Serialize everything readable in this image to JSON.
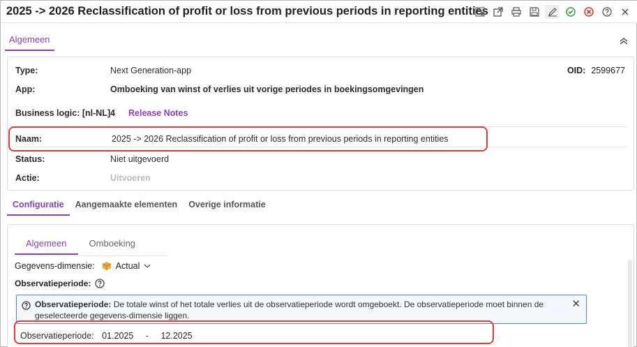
{
  "window": {
    "title": "2025 -> 2026 Reclassification of profit or loss from previous periods in reporting entities"
  },
  "toolbar": {
    "icons": [
      "layout-icon",
      "open-external-icon",
      "print-icon",
      "save-icon",
      "edit-icon",
      "approve-icon",
      "reject-icon",
      "help-icon",
      "close-icon"
    ]
  },
  "top_tab": {
    "label": "Algemeen"
  },
  "details": {
    "type_label": "Type:",
    "type_value": "Next Generation-app",
    "oid_label": "OID:",
    "oid_value": "2599677",
    "app_label": "App:",
    "app_value": "Omboeking van winst of verlies uit vorige periodes in boekingsomgevingen",
    "bl_label": "Business logic: [nl-NL]",
    "bl_value": "4",
    "release_notes": "Release Notes",
    "naam_label": "Naam:",
    "naam_value": "2025 -> 2026 Reclassification of profit or loss from previous periods in reporting entities",
    "status_label": "Status:",
    "status_value": "Niet uitgevoerd",
    "actie_label": "Actie:",
    "actie_value": "Uitvoeren"
  },
  "section_tabs": [
    "Configuratie",
    "Aangemaakte elementen",
    "Overige informatie"
  ],
  "inner_tabs": [
    "Algemeen",
    "Omboeking"
  ],
  "config": {
    "dimension_label": "Gegevens-dimensie:",
    "dimension_value": "Actual",
    "obs_label": "Observatieperiode:",
    "info_title": "Observatieperiode:",
    "info_text": "De totale winst of het totale verlies uit de observatieperiode wordt omgeboekt. De observatieperiode moet binnen de geselecteerde gegevens-dimensie liggen.",
    "period_label": "Observatieperiode:",
    "period_from": "01.2025",
    "period_sep": "-",
    "period_to": "12.2025"
  },
  "colors": {
    "accent": "#8a3fbf",
    "highlight": "#e53935",
    "info_border": "#4a86d9",
    "approve": "#2e9e3e",
    "reject": "#d93025"
  }
}
